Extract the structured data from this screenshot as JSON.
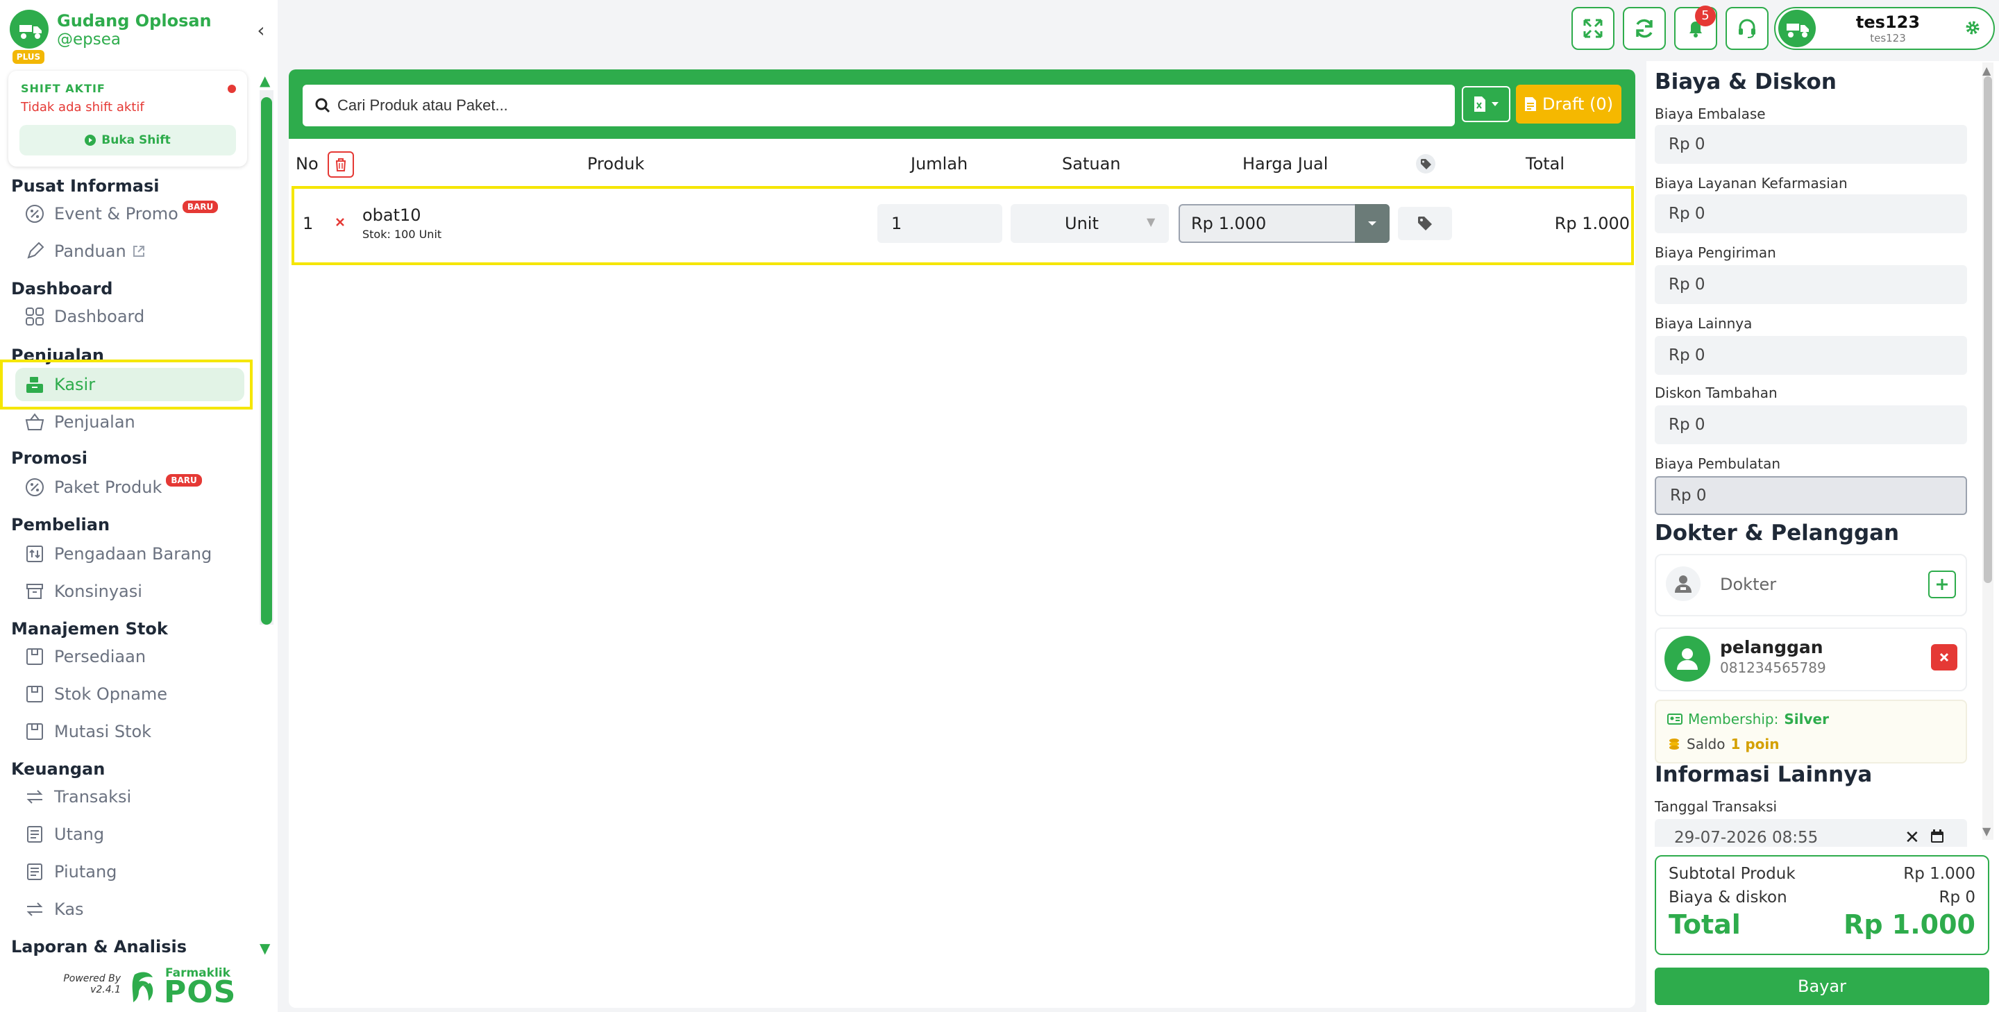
{
  "brand": {
    "name": "Gudang Oplosan",
    "handle": "@epsea",
    "plan": "PLUS"
  },
  "shift": {
    "title": "SHIFT AKTIF",
    "status": "Tidak ada shift aktif",
    "button": "Buka Shift"
  },
  "sidebar": {
    "sections": {
      "info": "Pusat Informasi",
      "dashboard": "Dashboard",
      "penjualan": "Penjualan",
      "promosi": "Promosi",
      "pembelian": "Pembelian",
      "stok": "Manajemen Stok",
      "keuangan": "Keuangan",
      "laporan": "Laporan & Analisis"
    },
    "items": {
      "event": "Event & Promo",
      "panduan": "Panduan",
      "dashboard": "Dashboard",
      "kasir": "Kasir",
      "penjualan": "Penjualan",
      "paket": "Paket Produk",
      "pengadaan": "Pengadaan Barang",
      "konsinyasi": "Konsinyasi",
      "persediaan": "Persediaan",
      "opname": "Stok Opname",
      "mutasi": "Mutasi Stok",
      "transaksi": "Transaksi",
      "utang": "Utang",
      "piutang": "Piutang",
      "kas": "Kas"
    },
    "badge_new": "BARU",
    "powered_by": "Powered By",
    "version": "v2.4.1",
    "logo_brand": "Farmaklik",
    "logo_product": "POS"
  },
  "topbar": {
    "notification_count": "5",
    "user_name": "tes123",
    "user_sub": "tes123"
  },
  "search": {
    "placeholder": "Cari Produk atau Paket..."
  },
  "draft": {
    "label": "Draft (0)"
  },
  "table": {
    "headers": {
      "no": "No",
      "produk": "Produk",
      "jumlah": "Jumlah",
      "satuan": "Satuan",
      "harga": "Harga Jual",
      "total": "Total"
    },
    "rows": [
      {
        "no": "1",
        "name": "obat10",
        "stock": "Stok: 100 Unit",
        "qty": "1",
        "unit": "Unit",
        "price_prefix": "Rp",
        "price": "1.000",
        "total": "Rp 1.000"
      }
    ]
  },
  "fees": {
    "title": "Biaya & Diskon",
    "prefix": "Rp",
    "items": [
      {
        "label": "Biaya Embalase",
        "value": "0"
      },
      {
        "label": "Biaya Layanan Kefarmasian",
        "value": "0"
      },
      {
        "label": "Biaya Pengiriman",
        "value": "0"
      },
      {
        "label": "Biaya Lainnya",
        "value": "0"
      },
      {
        "label": "Diskon Tambahan",
        "value": "0"
      },
      {
        "label": "Biaya Pembulatan",
        "value": "0"
      }
    ]
  },
  "customer_section": {
    "title": "Dokter & Pelanggan",
    "doctor_placeholder": "Dokter",
    "customer_name": "pelanggan",
    "customer_phone": "081234565789",
    "membership_label": "Membership:",
    "membership_value": "Silver",
    "saldo_label": "Saldo",
    "saldo_value": "1 poin"
  },
  "other_info": {
    "title": "Informasi Lainnya",
    "date_label": "Tanggal Transaksi",
    "date_value": "29-07-2026 08:55"
  },
  "summary": {
    "subtotal_label": "Subtotal Produk",
    "subtotal_value": "Rp 1.000",
    "fee_label": "Biaya & diskon",
    "fee_value": "Rp 0",
    "total_label": "Total",
    "total_value": "Rp 1.000",
    "pay_button": "Bayar"
  },
  "colors": {
    "primary": "#2eac4c",
    "accent": "#f5b800",
    "danger": "#e53935",
    "highlight": "#f5e600"
  }
}
